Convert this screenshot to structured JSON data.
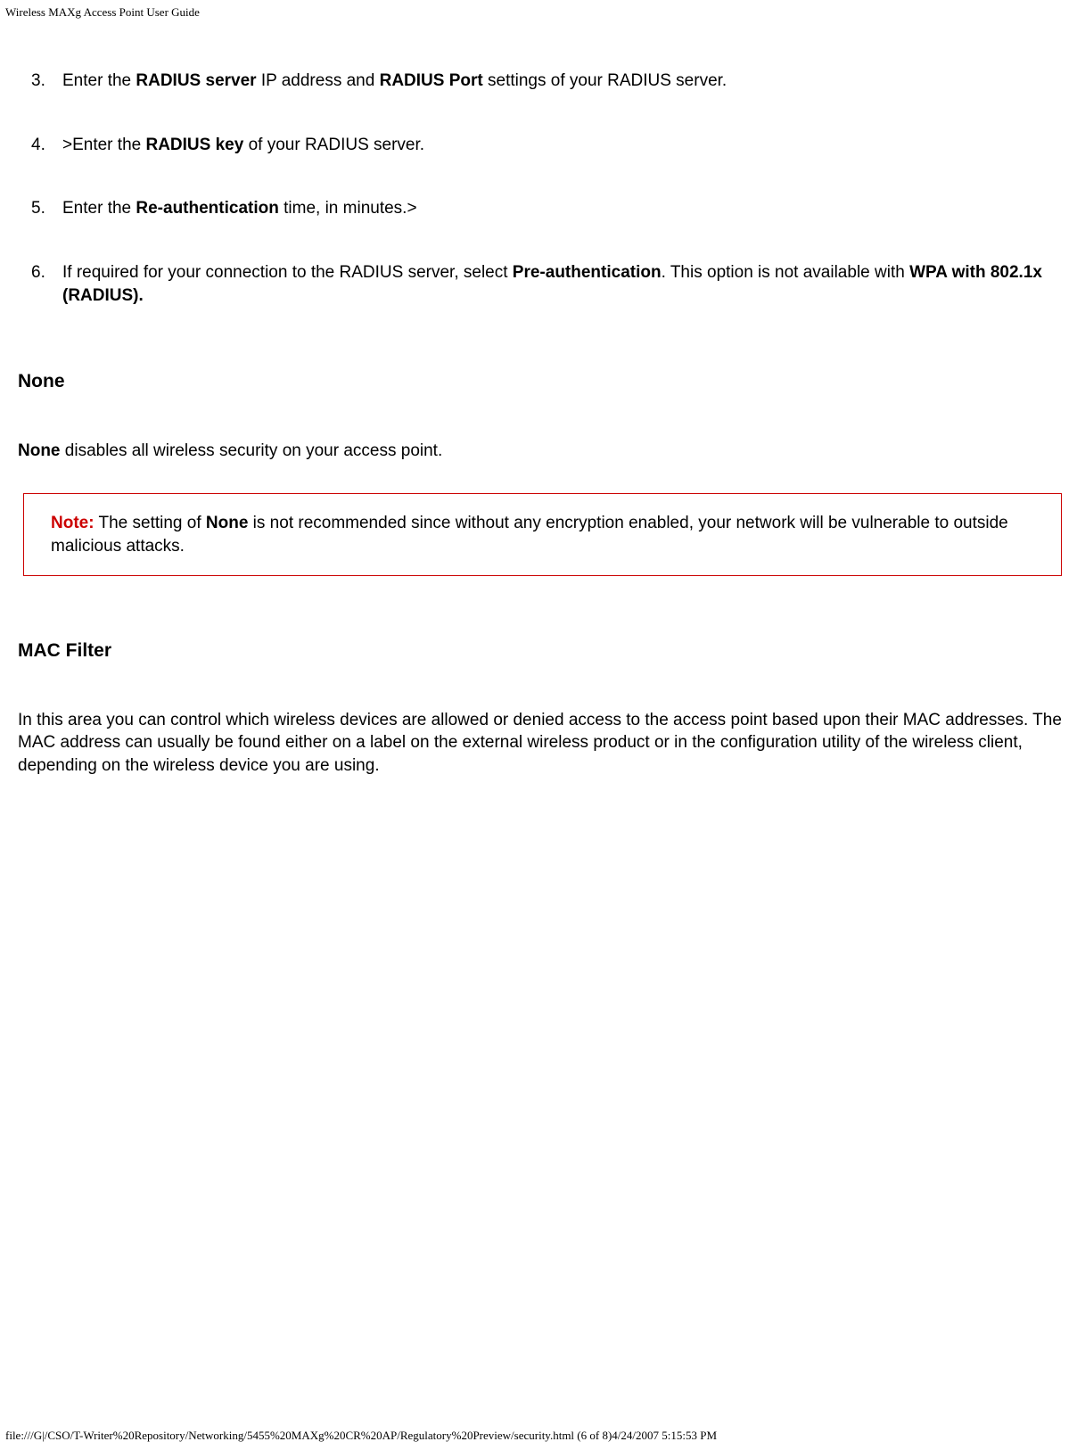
{
  "header": {
    "title": "Wireless MAXg Access Point User Guide"
  },
  "steps": {
    "s3_part1": "Enter the ",
    "s3_bold1": "RADIUS server",
    "s3_part2": " IP address and ",
    "s3_bold2": "RADIUS Port",
    "s3_part3": " settings of your RADIUS server.",
    "s4_part1": ">Enter the ",
    "s4_bold1": "RADIUS key",
    "s4_part2": " of your RADIUS server.",
    "s5_part1": "Enter the ",
    "s5_bold1": "Re-authentication",
    "s5_part2": " time, in minutes.>",
    "s6_part1": "If required for your connection to the RADIUS server, select ",
    "s6_bold1": "Pre-authentication",
    "s6_part2": ". This option is not available with ",
    "s6_bold2": "WPA with 802.1x (RADIUS)."
  },
  "sections": {
    "none_heading": "None",
    "none_bold": "None",
    "none_text": " disables all wireless security on your access point.",
    "mac_heading": "MAC Filter",
    "mac_text": "In this area you can control which wireless devices are allowed or denied access to the access point based upon their MAC addresses. The MAC address can usually be found either on a label on the external wireless product or in the configuration utility of the wireless client, depending on the wireless device you are using."
  },
  "note": {
    "label": "Note:",
    "part1": " The setting of ",
    "bold": "None",
    "part2": " is not recommended since without any encryption enabled, your network will be vulnerable to outside malicious attacks."
  },
  "footer": {
    "text": "file:///G|/CSO/T-Writer%20Repository/Networking/5455%20MAXg%20CR%20AP/Regulatory%20Preview/security.html (6 of 8)4/24/2007 5:15:53 PM"
  }
}
